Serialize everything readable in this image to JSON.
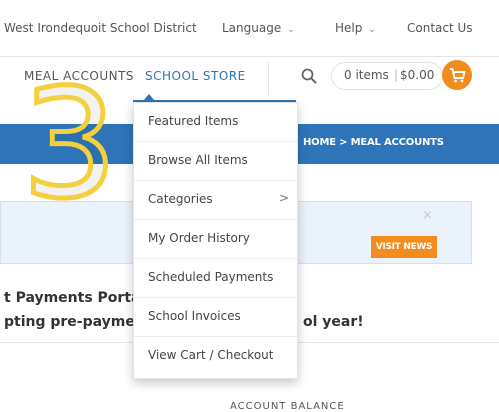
{
  "topbar": {
    "district": "West Irondequoit School District",
    "language": "Language",
    "help": "Help",
    "contact": "Contact Us"
  },
  "nav": {
    "meal_accounts": "MEAL ACCOUNTS",
    "school_store": "SCHOOL STORE"
  },
  "cart": {
    "items": "0 items",
    "total": "$0.00"
  },
  "breadcrumb": "HOME > MEAL ACCOUNTS",
  "notice": {
    "button": "VISIT NEWS",
    "close": "×"
  },
  "portal": {
    "title": "t Payments Porta",
    "subtitle_start": "pting pre-paymer",
    "subtitle_end": "ol year!"
  },
  "balance_label": "ACCOUNT BALANCE",
  "step_number": "3",
  "dropdown": {
    "items": [
      {
        "label": "Featured Items"
      },
      {
        "label": "Browse All Items"
      },
      {
        "label": "Categories",
        "arrow": ">"
      },
      {
        "label": "My Order History"
      },
      {
        "label": "Scheduled Payments"
      },
      {
        "label": "School Invoices"
      },
      {
        "label": "View Cart / Checkout"
      }
    ]
  },
  "colors": {
    "accent_blue": "#2f74b8",
    "accent_orange": "#f28c1e",
    "annotation_yellow": "#f4d03f"
  }
}
